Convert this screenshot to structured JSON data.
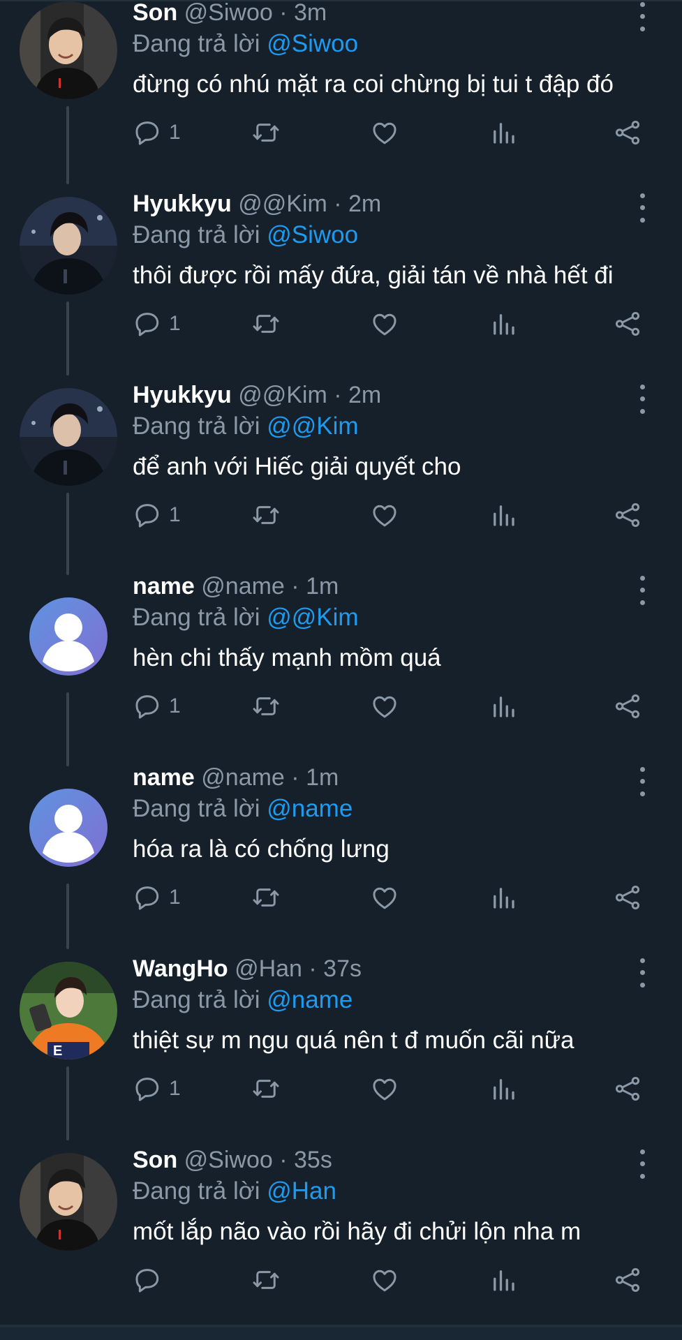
{
  "colors": {
    "background": "#15202b",
    "text": "#ffffff",
    "muted": "#8b98a5",
    "link": "#1d9bf0",
    "thread_line": "#38444d"
  },
  "labels": {
    "reply_prefix": "Đang trả lời"
  },
  "tweets": [
    {
      "name": "Son",
      "handle": "@Siwoo",
      "time": "3m",
      "reply_to": "@Siwoo",
      "text": "đừng có nhú mặt ra coi chừng bị tui t đập đó",
      "reply_count": "1",
      "avatar": "photo-boy-smile"
    },
    {
      "name": "Hyukkyu",
      "handle": "@@Kim",
      "time": "2m",
      "reply_to": "@Siwoo",
      "text": "thôi được rồi mấy đứa, giải tán về nhà hết đi",
      "reply_count": "1",
      "avatar": "photo-hyukkyu"
    },
    {
      "name": "Hyukkyu",
      "handle": "@@Kim",
      "time": "2m",
      "reply_to": "@@Kim",
      "text": "để anh với Hiếc giải quyết cho",
      "reply_count": "1",
      "avatar": "photo-hyukkyu"
    },
    {
      "name": "name",
      "handle": "@name",
      "time": "1m",
      "reply_to": "@@Kim",
      "text": "hèn chi thấy mạnh mồm quá",
      "reply_count": "1",
      "avatar": "default-avatar"
    },
    {
      "name": "name",
      "handle": "@name",
      "time": "1m",
      "reply_to": "@name",
      "text": "hóa ra là có chống lưng",
      "reply_count": "1",
      "avatar": "default-avatar"
    },
    {
      "name": "WangHo",
      "handle": "@Han",
      "time": "37s",
      "reply_to": "@name",
      "text": "thiệt sự m ngu quá nên t đ muốn cãi nữa",
      "reply_count": "1",
      "avatar": "photo-wangho"
    },
    {
      "name": "Son",
      "handle": "@Siwoo",
      "time": "35s",
      "reply_to": "@Han",
      "text": "mốt lắp não vào rồi hãy đi chửi lộn nha m",
      "reply_count": "",
      "avatar": "photo-boy-smile"
    }
  ]
}
